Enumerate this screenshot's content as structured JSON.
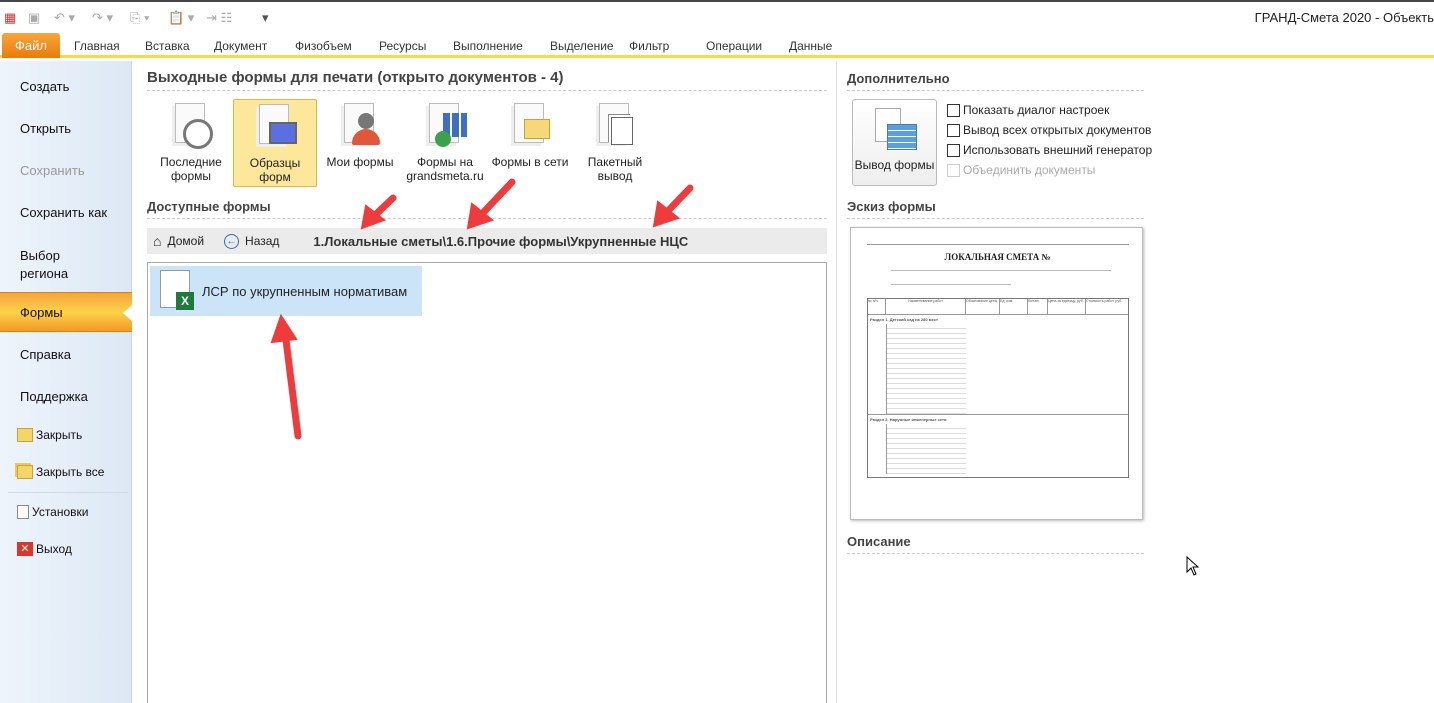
{
  "window": {
    "title": "ГРАНД-Смета 2020 - Объекть"
  },
  "ribbon_tabs": [
    "Файл",
    "Главная",
    "Вставка",
    "Документ",
    "Физобъем",
    "Ресурсы",
    "Выполнение",
    "Выделение",
    "Фильтр",
    "Операции",
    "Данные"
  ],
  "sidebar": {
    "items": [
      "Создать",
      "Открыть",
      "Сохранить",
      "Сохранить как",
      "Выбор региона",
      "Формы",
      "Справка",
      "Поддержка"
    ],
    "small": [
      "Закрыть",
      "Закрыть все",
      "Установки",
      "Выход"
    ]
  },
  "main": {
    "title": "Выходные формы для печати (открыто документов - 4)",
    "buttons": [
      {
        "l1": "Последние",
        "l2": "формы"
      },
      {
        "l1": "Образцы",
        "l2": "форм"
      },
      {
        "l1": "Мои формы",
        "l2": ""
      },
      {
        "l1": "Формы на",
        "l2": "grandsmeta.ru"
      },
      {
        "l1": "Формы в сети",
        "l2": ""
      },
      {
        "l1": "Пакетный",
        "l2": "вывод"
      }
    ],
    "available_title": "Доступные формы",
    "breadcrumb": {
      "home": "Домой",
      "back": "Назад",
      "path": "1.Локальные сметы\\1.6.Прочие формы\\Укрупненные НЦС"
    },
    "items": [
      "ЛСР по укрупненным нормативам"
    ]
  },
  "right": {
    "extra_title": "Дополнительно",
    "output_button": "Вывод формы",
    "checkboxes": [
      {
        "label": "Показать диалог настроек",
        "checked": false,
        "enabled": true
      },
      {
        "label": "Вывод всех открытых документов",
        "checked": false,
        "enabled": true
      },
      {
        "label": "Использовать внешний генератор",
        "checked": false,
        "enabled": true
      },
      {
        "label": "Объединить документы",
        "checked": false,
        "enabled": false
      }
    ],
    "sketch_title": "Эскиз формы",
    "description_title": "Описание"
  },
  "preview": {
    "heading": "ЛОКАЛЬНАЯ СМЕТА №",
    "section1": "Раздел 1. Детский сад на 280 мест",
    "section2": "Раздел 2. Наружные инженерные сети",
    "columns": [
      "№ п/п",
      "Наименование работ",
      "Обоснование цены",
      "Ед. изм.",
      "Кол-во",
      "Цена за единицу, руб.",
      "Стоимость работ, руб."
    ]
  },
  "colors": {
    "accent": "#f39a25",
    "arrow": "#ef3b3b",
    "selection": "#cce4f7"
  }
}
